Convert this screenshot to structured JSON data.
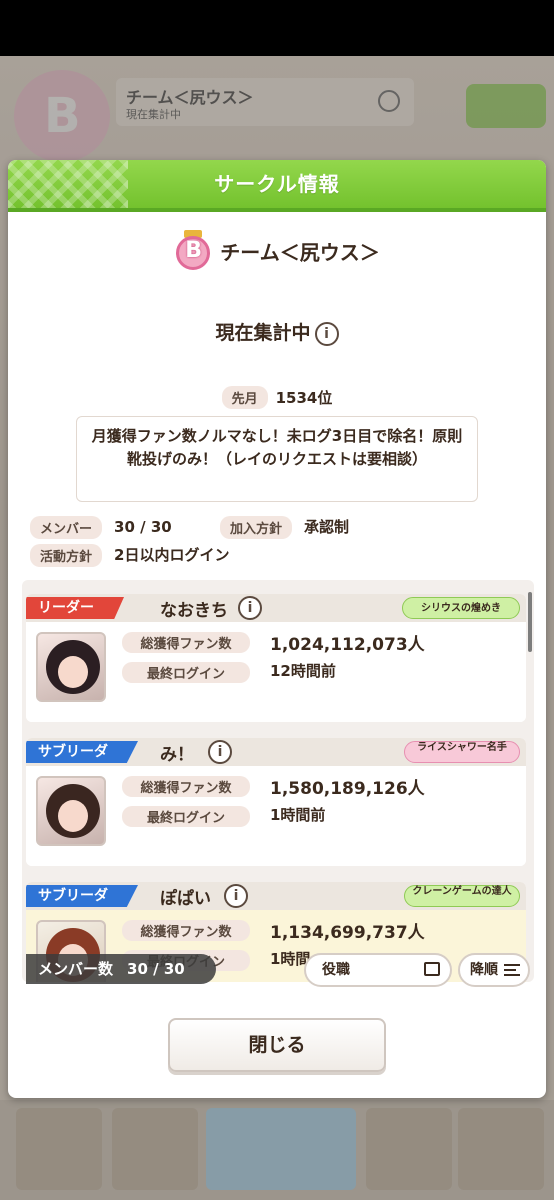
{
  "background": {
    "rank_letter": "B",
    "circle_name": "チーム＜尻ウス＞",
    "circle_sub": "現在集計中"
  },
  "dialog": {
    "title": "サークル情報",
    "rank_letter": "B",
    "circle_name": "チーム＜尻ウス＞",
    "status": "現在集計中",
    "info_glyph": "i",
    "last_month_label": "先月",
    "last_month_value": "1534位",
    "description": "月獲得ファン数ノルマなし！未ログ3日目で除名！原則靴投げのみ！（レイのリクエストは要相談）",
    "members_label": "メンバー",
    "members_value": "30 / 30",
    "join_label": "加入方針",
    "join_value": "承認制",
    "activity_label": "活動方針",
    "activity_value": "2日以内ログイン",
    "close_label": "閉じる"
  },
  "list": {
    "fans_label": "総獲得ファン数",
    "login_label": "最終ログイン",
    "member_count_label": "メンバー数",
    "member_count_value": "30 / 30",
    "role_filter_label": "役職",
    "sort_label": "降順",
    "members": [
      {
        "role": "リーダー",
        "name": "なおきち",
        "title": "シリウスの煌めき",
        "fans": "1,024,112,073人",
        "login": "12時間前"
      },
      {
        "role": "サブリーダー",
        "name": "み！",
        "title": "ライスシャワー名手",
        "fans": "1,580,189,126人",
        "login": "1時間前"
      },
      {
        "role": "サブリーダー",
        "name": "ぽぱい",
        "title": "クレーンゲームの達人",
        "fans": "1,134,699,737人",
        "login": "1時間"
      }
    ]
  },
  "colors": {
    "header_green": "#7fc83a",
    "leader_red": "#e2463a",
    "subleader_blue": "#2f74d6"
  }
}
